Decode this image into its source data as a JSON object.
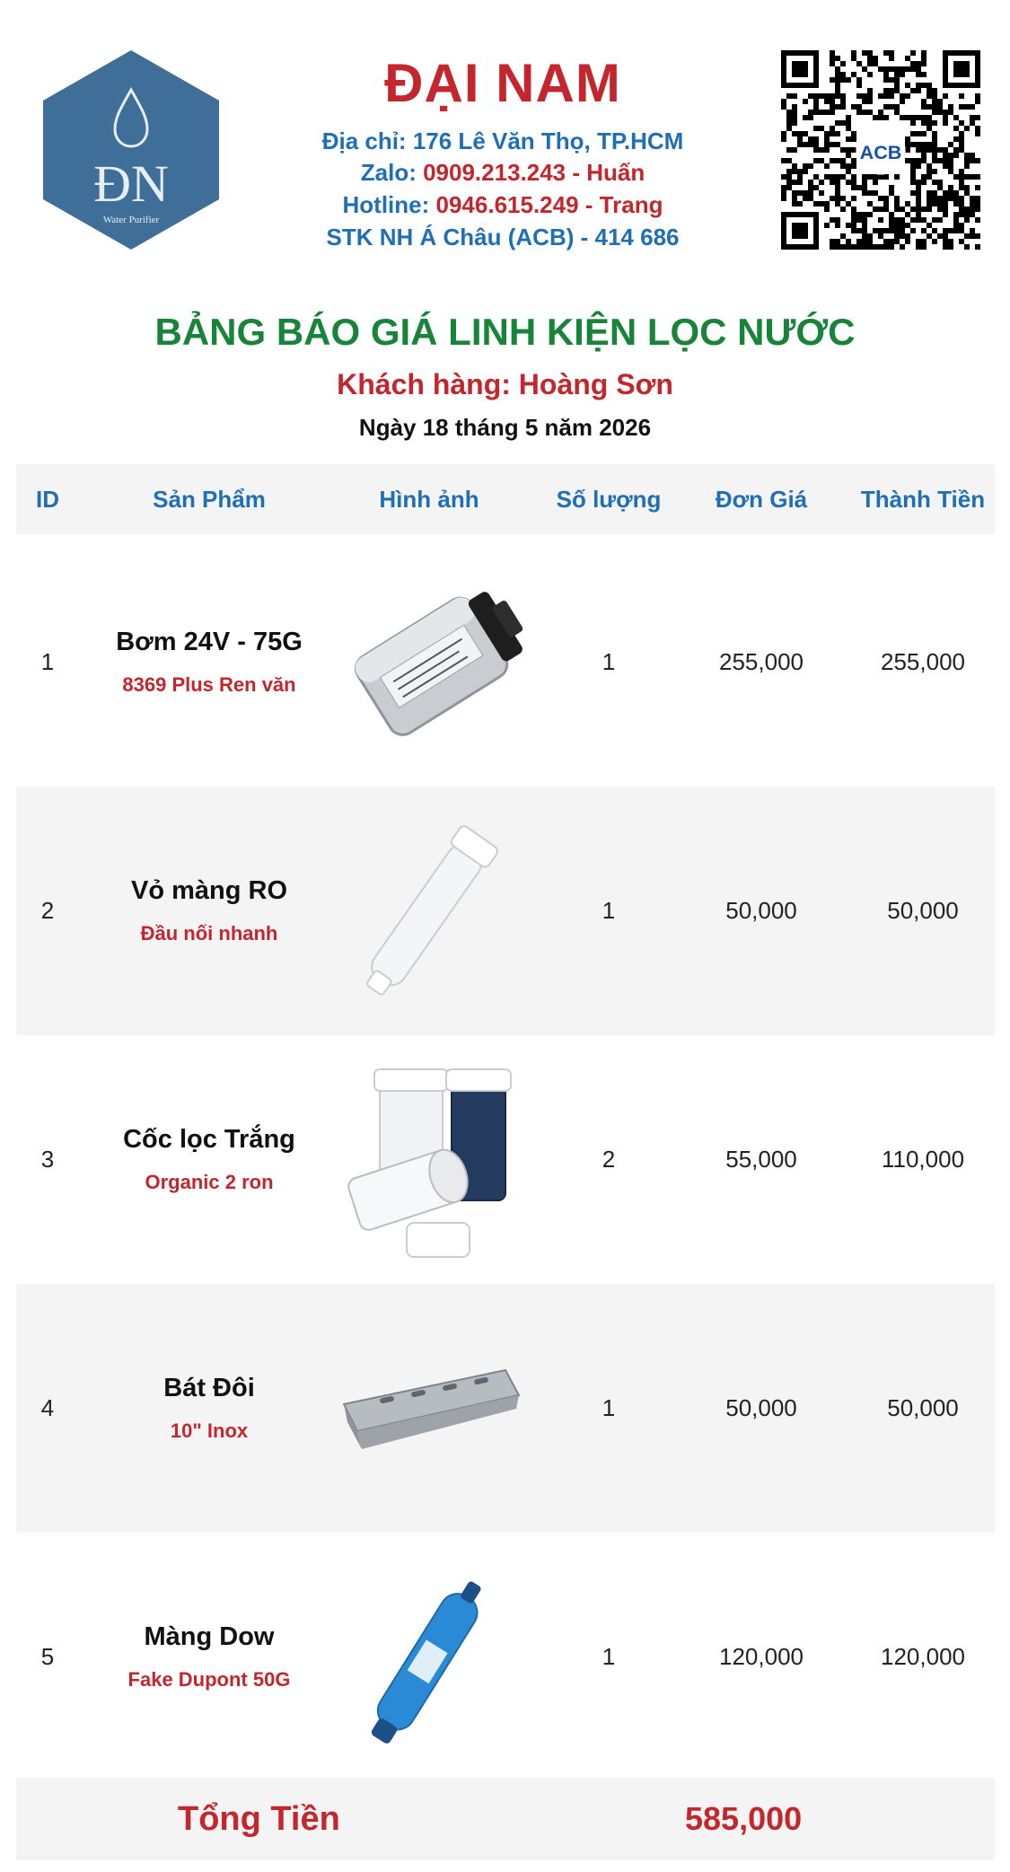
{
  "header": {
    "logo_monogram": "ĐN",
    "logo_tagline": "Water Purifier",
    "brand_name": "ĐẠI NAM",
    "address_label": "Địa chỉ: ",
    "address_value": "176 Lê Văn Thọ, TP.HCM",
    "zalo_label": "Zalo: ",
    "zalo_value": "0909.213.243 - Huấn",
    "hotline_label": "Hotline: ",
    "hotline_value": "0946.615.249 - Trang",
    "bank_label": "STK NH Á Châu (ACB) - ",
    "bank_value": "414 686",
    "qr_badge": "ACB"
  },
  "document": {
    "title": "BẢNG BÁO GIÁ LINH KIỆN LỌC NƯỚC",
    "customer": "Khách hàng: Hoàng Sơn",
    "date": "Ngày 18 tháng 5 năm 2026"
  },
  "table": {
    "headers": {
      "id": "ID",
      "product": "Sản Phẩm",
      "image": "Hình ảnh",
      "quantity": "Số lượng",
      "unit_price": "Đơn Giá",
      "total": "Thành Tiền"
    },
    "rows": [
      {
        "id": "1",
        "name": "Bơm 24V - 75G",
        "desc": "8369 Plus Ren văn",
        "image": "pump-image",
        "qty": "1",
        "price": "255,000",
        "total": "255,000"
      },
      {
        "id": "2",
        "name": "Vỏ màng RO",
        "desc": "Đầu nối nhanh",
        "image": "ro-housing-image",
        "qty": "1",
        "price": "50,000",
        "total": "50,000"
      },
      {
        "id": "3",
        "name": "Cốc lọc Trắng",
        "desc": "Organic 2 ron",
        "image": "filter-housing-image",
        "qty": "2",
        "price": "55,000",
        "total": "110,000"
      },
      {
        "id": "4",
        "name": "Bát Đôi",
        "desc": "10\" Inox",
        "image": "bracket-image",
        "qty": "1",
        "price": "50,000",
        "total": "50,000"
      },
      {
        "id": "5",
        "name": "Màng Dow",
        "desc": "Fake Dupont 50G",
        "image": "membrane-image",
        "qty": "1",
        "price": "120,000",
        "total": "120,000"
      }
    ]
  },
  "summary": {
    "label": "Tổng Tiền",
    "value": "585,000"
  },
  "colors": {
    "brand_red": "#c4262e",
    "info_blue": "#1f6fb7",
    "title_green": "#17843a",
    "row_shade": "#f4f4f4",
    "logo_blue": "#3f6f99"
  }
}
